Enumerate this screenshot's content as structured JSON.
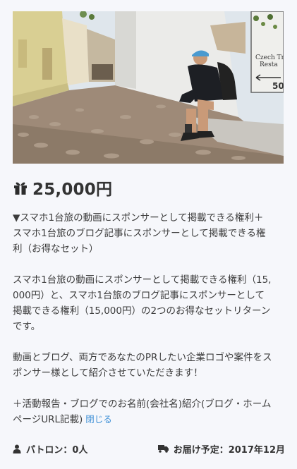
{
  "reward": {
    "image_alt": "Traveler sitting on cobblestone street",
    "sign_text": [
      "Czech Tr",
      "Resta",
      "50"
    ],
    "price": "25,000円",
    "description": [
      "▼スマホ1台旅の動画にスポンサーとして掲載できる権利＋\nスマホ1台旅のブログ記事にスポンサーとして掲載できる権\n利（お得なセット）",
      "スマホ1台旅の動画にスポンサーとして掲載できる権利（15,\n000円）と、スマホ1台旅のブログ記事にスポンサーとして\n掲載できる権利（15,000円）の2つのお得なセットリターン\nです。",
      "動画とブログ、両方であなたのPRしたい企業ロゴや案件をス\nポンサー様として紹介させていただきます！"
    ],
    "description_last": "＋活動報告・ブログでのお名前(会社名)紹介(ブログ・ホーム\nページURL記載)",
    "close_label": "閉じる",
    "patron_label": "パトロン：0人",
    "delivery_label": "お届け予定：2017年12月"
  },
  "icons": {
    "gift": "gift-icon",
    "user": "user-icon",
    "truck": "truck-icon"
  }
}
